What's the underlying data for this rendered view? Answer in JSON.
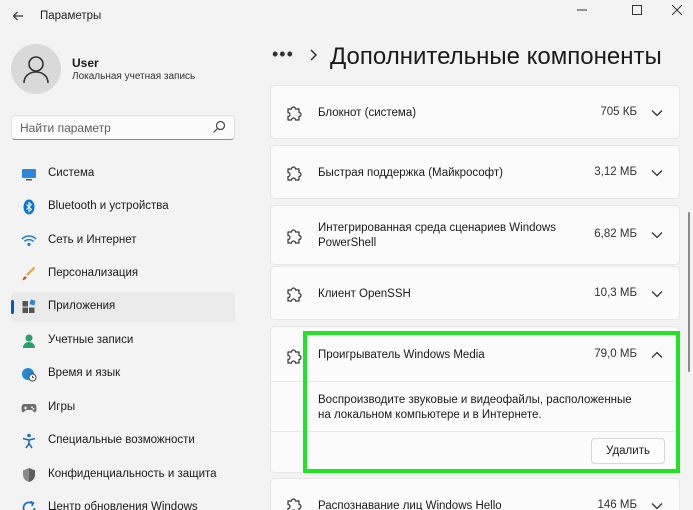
{
  "window": {
    "title": "Параметры",
    "back_icon": "arrow-left-icon",
    "controls": [
      "minimize-icon",
      "maximize-icon",
      "close-icon"
    ]
  },
  "user": {
    "name": "User",
    "account_type": "Локальная учетная запись"
  },
  "search": {
    "placeholder": "Найти параметр"
  },
  "sidebar": {
    "items": [
      {
        "label": "Система",
        "icon": "monitor-icon"
      },
      {
        "label": "Bluetooth и устройства",
        "icon": "bluetooth-icon"
      },
      {
        "label": "Сеть и Интернет",
        "icon": "wifi-icon"
      },
      {
        "label": "Персонализация",
        "icon": "brush-icon"
      },
      {
        "label": "Приложения",
        "icon": "apps-icon",
        "active": true
      },
      {
        "label": "Учетные записи",
        "icon": "person-icon"
      },
      {
        "label": "Время и язык",
        "icon": "globe-clock-icon"
      },
      {
        "label": "Игры",
        "icon": "gamepad-icon"
      },
      {
        "label": "Специальные возможности",
        "icon": "accessibility-icon"
      },
      {
        "label": "Конфиденциальность и защита",
        "icon": "shield-icon"
      },
      {
        "label": "Центр обновления Windows",
        "icon": "update-icon"
      }
    ]
  },
  "breadcrumb": {
    "overflow": "•••",
    "title": "Дополнительные компоненты"
  },
  "features": [
    {
      "name": "Блокнот (система)",
      "size": "705 КБ"
    },
    {
      "name": "Быстрая поддержка (Майкрософт)",
      "size": "3,12 МБ"
    },
    {
      "name_line1": "Интегрированная среда сценариев Windows",
      "name_line2": "PowerShell",
      "size": "6,82 МБ"
    },
    {
      "name": "Клиент OpenSSH",
      "size": "10,3 МБ"
    },
    {
      "name": "Проигрыватель Windows Media",
      "size": "79,0 МБ",
      "expanded": true,
      "desc_line1": "Воспроизводите звуковые и видеофайлы, расположенные",
      "desc_line2": "на локальном компьютере и в Интернете.",
      "remove_label": "Удалить"
    },
    {
      "name": "Распознавание лиц Windows Hello",
      "size": "146 МБ"
    }
  ],
  "colors": {
    "accent": "#005fb8",
    "highlight": "#22e322",
    "background": "#f3f3f3",
    "card": "#fbfbfb"
  }
}
